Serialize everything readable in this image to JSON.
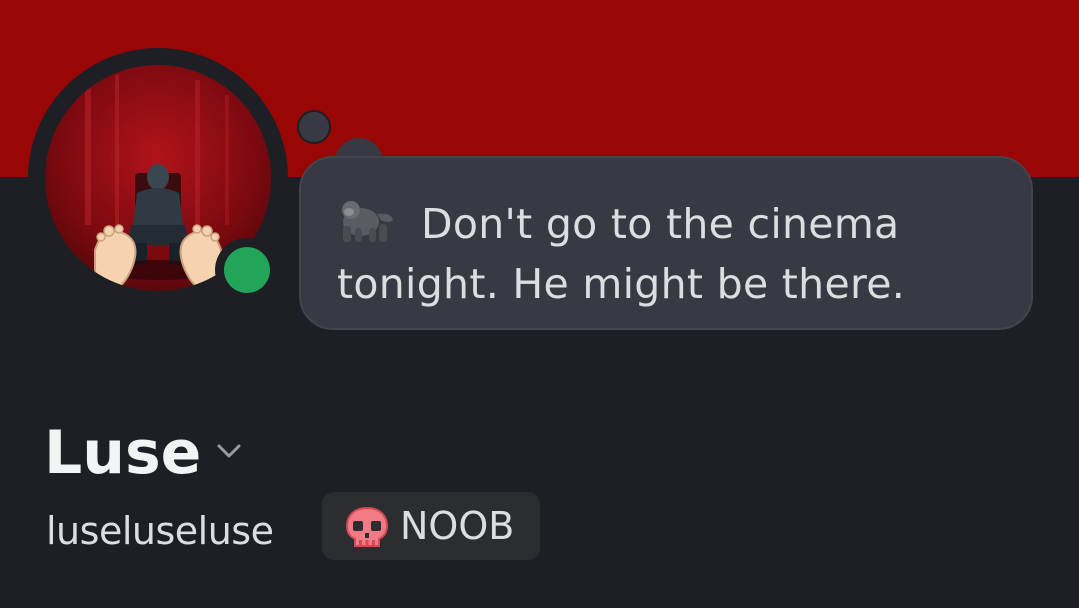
{
  "profile": {
    "display_name": "Luse",
    "username": "luseluseluse",
    "status_text_line1": "Don't go to the cinema",
    "status_text_line2": "tonight. He might be there.",
    "status_emoji": "gorilla-icon",
    "presence": "online",
    "tag": {
      "label": "NOOB",
      "icon": "skull-icon"
    }
  },
  "colors": {
    "banner": "#990606",
    "background": "#1e1f24",
    "bubble": "#383a43",
    "online": "#23a559"
  }
}
